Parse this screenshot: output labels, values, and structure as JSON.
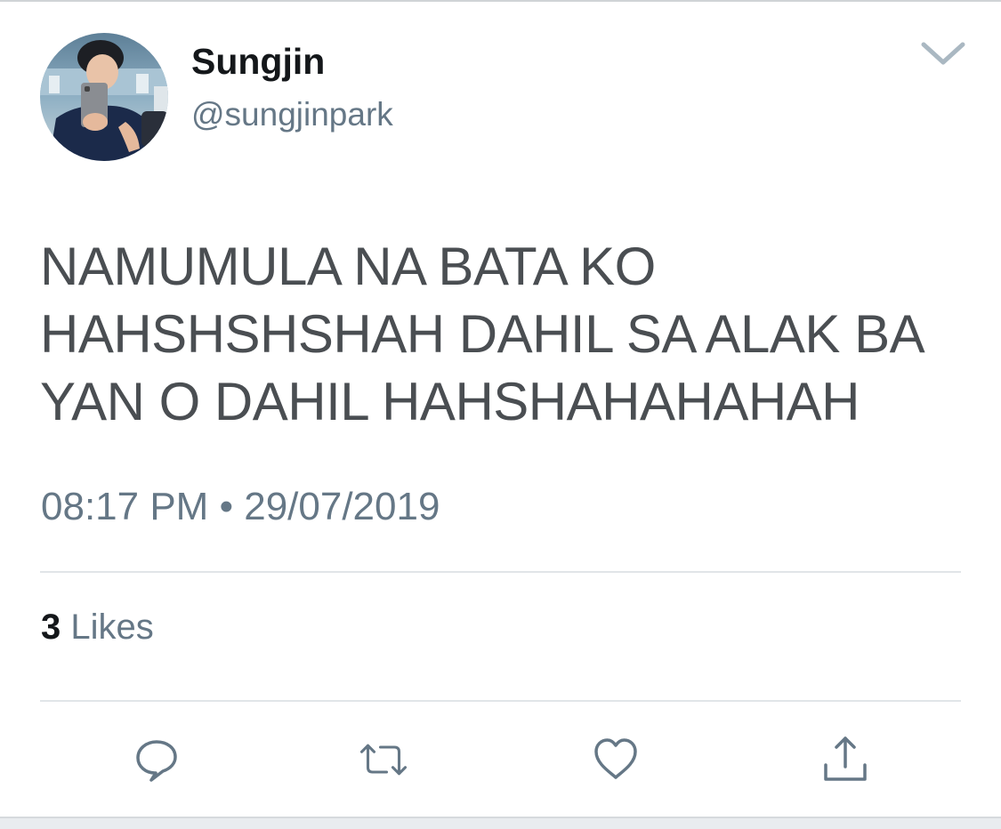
{
  "tweet": {
    "author": {
      "display_name": "Sungjin",
      "handle": "@sungjinpark"
    },
    "text": "NAMUMULA NA BATA KO HAHSHSHSHAH DAHIL SA ALAK BA YAN O DAHIL HAHSHAHAHAHAH",
    "time": "08:17 PM",
    "separator": "•",
    "date": "29/07/2019",
    "likes": {
      "count": "3",
      "label": "Likes"
    }
  },
  "actions": {
    "reply": "reply-icon",
    "retweet": "retweet-icon",
    "like": "heart-icon",
    "share": "share-icon"
  },
  "colors": {
    "text_primary": "#14171a",
    "text_secondary": "#657786",
    "tweet_body": "#4a4e52",
    "icon": "#657786",
    "divider": "#e1e5e8"
  }
}
